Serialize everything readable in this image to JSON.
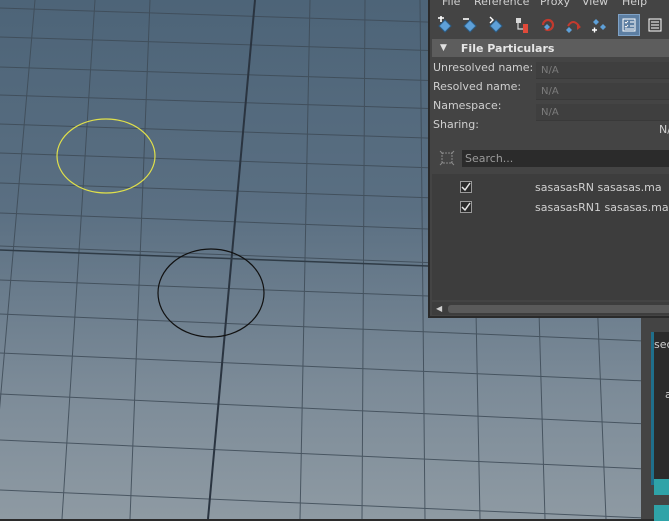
{
  "menu": {
    "items": [
      "File",
      "Reference",
      "Proxy",
      "View",
      "Help"
    ]
  },
  "toolbar": {
    "icons": [
      "add-reference-icon",
      "remove-reference-icon",
      "import-reference-icon",
      "reference-hierarchy-icon",
      "reload-reference-icon",
      "replace-reference-icon",
      "proxy-reference-icon",
      "list-view-icon",
      "details-view-icon"
    ]
  },
  "file_particulars": {
    "header": "File Particulars",
    "unresolved_label": "Unresolved name:",
    "unresolved_value": "N/A",
    "resolved_label": "Resolved name:",
    "resolved_value": "N/A",
    "namespace_label": "Namespace:",
    "namespace_value": "N/A",
    "sharing_label": "Sharing:",
    "sharing_value": "N/"
  },
  "search": {
    "placeholder": "Search..."
  },
  "references": [
    {
      "label": "sasasasRN sasasas.ma",
      "checked": true
    },
    {
      "label": "sasasasRN1 sasasas.ma",
      "checked": true
    }
  ],
  "right_dock": {
    "label_fragment": "sec",
    "letter_fragment": "a"
  },
  "colors": {
    "selected_circle": "#e0e04a",
    "circle": "#111111",
    "accent_blue": "#5d7fa3",
    "teal": "#2fa3a8"
  }
}
